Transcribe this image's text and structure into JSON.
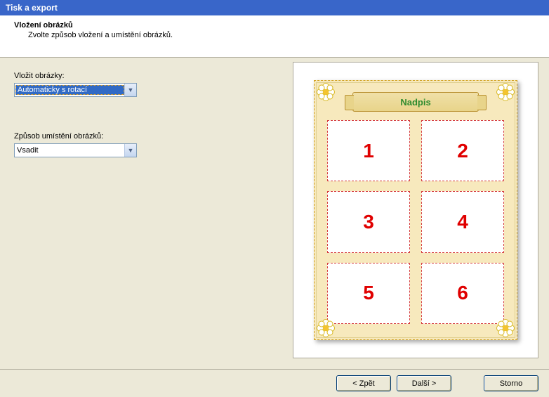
{
  "window": {
    "title": "Tisk a export"
  },
  "header": {
    "title": "Vložení obrázků",
    "subtitle": "Zvolte způsob vložení a umístění obrázků."
  },
  "form": {
    "insert_label": "Vložit obrázky:",
    "insert_value": "Automaticky s rotací",
    "placement_label": "Způsob umístění obrázků:",
    "placement_value": "Vsadit"
  },
  "preview": {
    "banner": "Nadpis",
    "cells": [
      "1",
      "2",
      "3",
      "4",
      "5",
      "6"
    ]
  },
  "buttons": {
    "back": "< Zpět",
    "next": "Další >",
    "cancel": "Storno"
  }
}
